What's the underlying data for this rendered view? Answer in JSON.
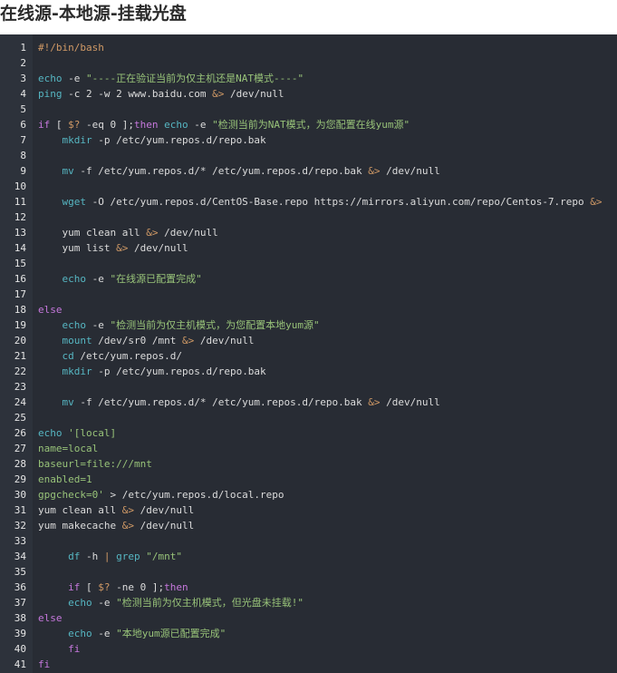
{
  "page": {
    "title": "在线源-本地源-挂载光盘"
  },
  "code": {
    "lines": [
      [
        [
          "c",
          "#!/bin/bash"
        ]
      ],
      [],
      [
        [
          "b",
          "echo"
        ],
        [
          "p",
          " -e "
        ],
        [
          "s",
          "\"----正在验证当前为仅主机还是NAT模式----\""
        ]
      ],
      [
        [
          "b",
          "ping"
        ],
        [
          "p",
          " -c 2 -w 2 www.baidu.com "
        ],
        [
          "o",
          "&>"
        ],
        [
          "p",
          " /dev/null"
        ]
      ],
      [],
      [
        [
          "k",
          "if"
        ],
        [
          "p",
          " [ "
        ],
        [
          "c",
          "$?"
        ],
        [
          "p",
          " -eq 0 ];"
        ],
        [
          "k",
          "then"
        ],
        [
          "p",
          " "
        ],
        [
          "b",
          "echo"
        ],
        [
          "p",
          " -e "
        ],
        [
          "s",
          "\"检测当前为NAT模式，为您配置在线yum源\""
        ]
      ],
      [
        [
          "p",
          "    "
        ],
        [
          "b",
          "mkdir"
        ],
        [
          "p",
          " -p /etc/yum.repos.d/repo.bak"
        ]
      ],
      [],
      [
        [
          "p",
          "    "
        ],
        [
          "b",
          "mv"
        ],
        [
          "p",
          " -f /etc/yum.repos.d/* /etc/yum.repos.d/repo.bak "
        ],
        [
          "o",
          "&>"
        ],
        [
          "p",
          " /dev/null"
        ]
      ],
      [],
      [
        [
          "p",
          "    "
        ],
        [
          "b",
          "wget"
        ],
        [
          "p",
          " -O /etc/yum.repos.d/CentOS-Base.repo https://mirrors.aliyun.com/repo/Centos-7.repo "
        ],
        [
          "o",
          "&>"
        ]
      ],
      [],
      [
        [
          "p",
          "    yum clean all "
        ],
        [
          "o",
          "&>"
        ],
        [
          "p",
          " /dev/null"
        ]
      ],
      [
        [
          "p",
          "    yum list "
        ],
        [
          "o",
          "&>"
        ],
        [
          "p",
          " /dev/null"
        ]
      ],
      [],
      [
        [
          "p",
          "    "
        ],
        [
          "b",
          "echo"
        ],
        [
          "p",
          " -e "
        ],
        [
          "s",
          "\"在线源已配置完成\""
        ]
      ],
      [],
      [
        [
          "k",
          "else"
        ]
      ],
      [
        [
          "p",
          "    "
        ],
        [
          "b",
          "echo"
        ],
        [
          "p",
          " -e "
        ],
        [
          "s",
          "\"检测当前为仅主机模式，为您配置本地yum源\""
        ]
      ],
      [
        [
          "p",
          "    "
        ],
        [
          "b",
          "mount"
        ],
        [
          "p",
          " /dev/sr0 /mnt "
        ],
        [
          "o",
          "&>"
        ],
        [
          "p",
          " /dev/null"
        ]
      ],
      [
        [
          "p",
          "    "
        ],
        [
          "b",
          "cd"
        ],
        [
          "p",
          " /etc/yum.repos.d/"
        ]
      ],
      [
        [
          "p",
          "    "
        ],
        [
          "b",
          "mkdir"
        ],
        [
          "p",
          " -p /etc/yum.repos.d/repo.bak"
        ]
      ],
      [],
      [
        [
          "p",
          "    "
        ],
        [
          "b",
          "mv"
        ],
        [
          "p",
          " -f /etc/yum.repos.d/* /etc/yum.repos.d/repo.bak "
        ],
        [
          "o",
          "&>"
        ],
        [
          "p",
          " /dev/null"
        ]
      ],
      [],
      [
        [
          "b",
          "echo"
        ],
        [
          "p",
          " "
        ],
        [
          "s",
          "'[local]"
        ]
      ],
      [
        [
          "s",
          "name=local"
        ]
      ],
      [
        [
          "s",
          "baseurl=file:///mnt"
        ]
      ],
      [
        [
          "s",
          "enabled=1"
        ]
      ],
      [
        [
          "s",
          "gpgcheck=0'"
        ],
        [
          "p",
          " > /etc/yum.repos.d/local.repo"
        ]
      ],
      [
        [
          "p",
          "yum clean all "
        ],
        [
          "o",
          "&>"
        ],
        [
          "p",
          " /dev/null"
        ]
      ],
      [
        [
          "p",
          "yum makecache "
        ],
        [
          "o",
          "&>"
        ],
        [
          "p",
          " /dev/null"
        ]
      ],
      [],
      [
        [
          "p",
          "     "
        ],
        [
          "b",
          "df"
        ],
        [
          "p",
          " -h "
        ],
        [
          "o",
          "|"
        ],
        [
          "p",
          " "
        ],
        [
          "b",
          "grep"
        ],
        [
          "p",
          " "
        ],
        [
          "s",
          "\"/mnt\""
        ]
      ],
      [],
      [
        [
          "p",
          "     "
        ],
        [
          "k",
          "if"
        ],
        [
          "p",
          " [ "
        ],
        [
          "c",
          "$?"
        ],
        [
          "p",
          " -ne 0 ];"
        ],
        [
          "k",
          "then"
        ]
      ],
      [
        [
          "p",
          "     "
        ],
        [
          "b",
          "echo"
        ],
        [
          "p",
          " -e "
        ],
        [
          "s",
          "\"检测当前为仅主机模式，但光盘未挂载!\""
        ]
      ],
      [
        [
          "k",
          "else"
        ]
      ],
      [
        [
          "p",
          "     "
        ],
        [
          "b",
          "echo"
        ],
        [
          "p",
          " -e "
        ],
        [
          "s",
          "\"本地yum源已配置完成\""
        ]
      ],
      [
        [
          "p",
          "     "
        ],
        [
          "k",
          "fi"
        ]
      ],
      [
        [
          "k",
          "fi"
        ]
      ]
    ]
  }
}
